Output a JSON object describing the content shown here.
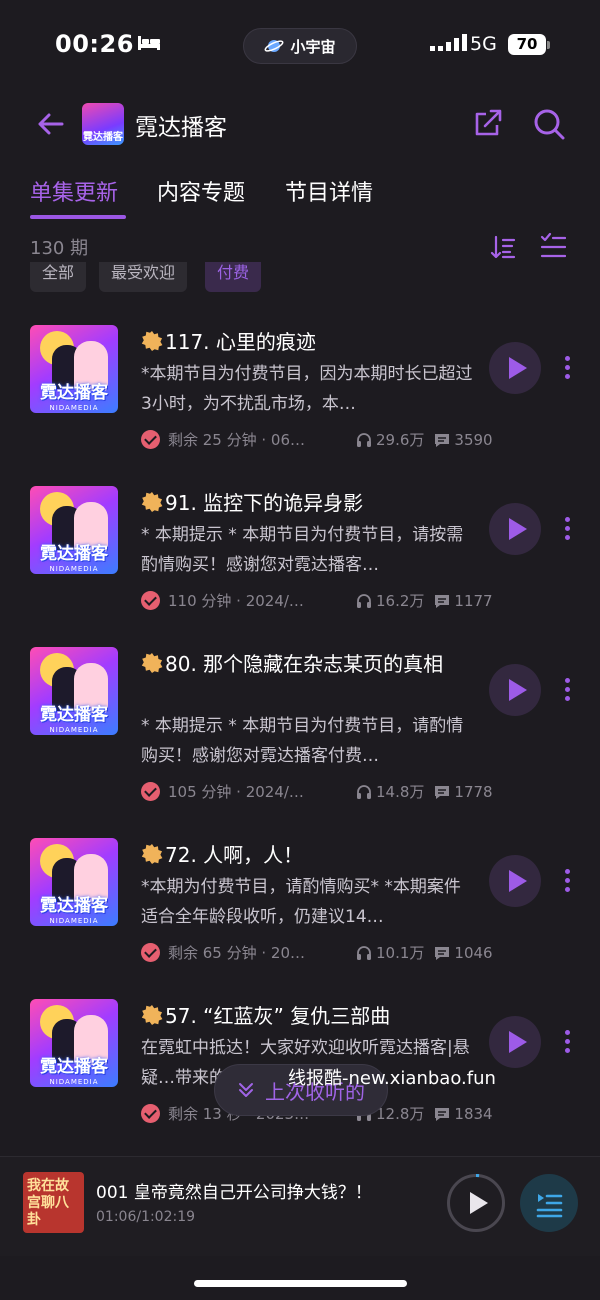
{
  "status_bar": {
    "time": "00:26",
    "center_pill": "小宇宙",
    "network": "5G",
    "battery": "70"
  },
  "header": {
    "title": "霓达播客",
    "logo_text": "霓达播客"
  },
  "tabs": [
    {
      "label": "单集更新",
      "active": true
    },
    {
      "label": "内容专题",
      "active": false
    },
    {
      "label": "节目详情",
      "active": false
    }
  ],
  "episode_count": "130 期",
  "filters": [
    {
      "label": "全部",
      "selected": false
    },
    {
      "label": "最受欢迎",
      "selected": false
    },
    {
      "label": "付费",
      "selected": true
    }
  ],
  "cover_text": "霓达播客",
  "cover_sub": "NIDAMEDIA",
  "episodes": [
    {
      "title": "117. 心里的痕迹",
      "desc": "*本期节目为付费节目，因为本期时长已超过3小时，为不扰乱市场，本…",
      "time": "剩余 25 分钟 · 06…",
      "listens": "29.6万",
      "comments": "3590"
    },
    {
      "title": "91. 监控下的诡异身影",
      "desc": "* 本期提示 * 本期节目为付费节目，请按需酌情购买！感谢您对霓达播客…",
      "time": "110 分钟 · 2024/…",
      "listens": "16.2万",
      "comments": "1177"
    },
    {
      "title": "80. 那个隐藏在杂志某页的真相",
      "desc": "* 本期提示 * 本期节目为付费节目，请酌情购买！感谢您对霓达播客付费…",
      "time": "105 分钟 · 2024/…",
      "listens": "14.8万",
      "comments": "1778"
    },
    {
      "title": "72. 人啊，人！",
      "desc": "*本期为付费节目，请酌情购买* *本期案件适合全年龄段收听，仍建议14…",
      "time": "剩余 65 分钟 · 20…",
      "listens": "10.1万",
      "comments": "1046"
    },
    {
      "title": "57. “红蓝灰” 复仇三部曲",
      "desc": "在霓虹中抵达！大家好欢迎收听霓达播客|悬疑…带来的…",
      "time": "剩余 13 秒 · 2023…",
      "listens": "12.8万",
      "comments": "1834"
    }
  ],
  "resume_button": "上次收听的",
  "watermark": "线报酷-new.xianbao.fun",
  "now_playing": {
    "cover_text": "我在故宫聊八卦",
    "title": "001 皇帝竟然自己开公司挣大钱？！",
    "progress_text": "01:06/1:02:19",
    "progress": 0.018
  },
  "colors": {
    "accent": "#9b57e4",
    "background": "#1d1b20",
    "check": "#e65f70"
  },
  "icons": [
    "back-arrow-icon",
    "share-icon",
    "search-icon",
    "sort-icon",
    "filter-list-icon",
    "play-icon",
    "more-icon",
    "headphones-icon",
    "comment-icon",
    "check-icon",
    "playlist-icon"
  ]
}
